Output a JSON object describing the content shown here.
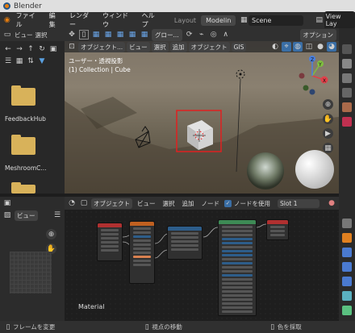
{
  "window": {
    "title": "Blender"
  },
  "menubar": {
    "items": [
      "ファイル",
      "編集",
      "レンダー",
      "ウィンドウ",
      "ヘルプ"
    ],
    "workspace_tabs": [
      "Layout",
      "Modelin"
    ],
    "scene": "Scene",
    "view_layer": "View Lay"
  },
  "filebrowser": {
    "header": {
      "view": "ビュー",
      "select": "選択"
    },
    "folders": [
      {
        "label": "FeedbackHub"
      },
      {
        "label": "MeshroomC..."
      }
    ]
  },
  "viewport": {
    "header": {
      "mode": "オブジェクト...",
      "transform": "グロー...",
      "options": "オプション"
    },
    "subheader": {
      "view": "ビュー",
      "select": "選択",
      "add": "追加",
      "object": "オブジェクト",
      "gis": "GIS"
    },
    "overlay": {
      "view_name": "ユーザー・透視投影",
      "collection": "(1) Collection | Cube"
    },
    "gizmo": {
      "x": "X",
      "y": "Y",
      "z": "Z"
    }
  },
  "node_editor": {
    "header": {
      "mode": "オブジェクト",
      "view": "ビュー",
      "select": "選択",
      "add": "追加",
      "node": "ノード",
      "use_nodes": "ノードを使用",
      "slot": "Slot 1"
    },
    "material_label": "Material"
  },
  "image_editor": {
    "view": "ビュー"
  },
  "statusbar": {
    "left": "フレームを変更",
    "middle": "視点の移動",
    "right": "色を採取"
  },
  "colors": {
    "accent": "#e87d0d",
    "selection": "#e02020",
    "header_bg": "#303030",
    "node_blue": "#2d5d8a",
    "node_red": "#b03030",
    "node_green": "#3d8a55",
    "node_orange": "#c06020"
  }
}
